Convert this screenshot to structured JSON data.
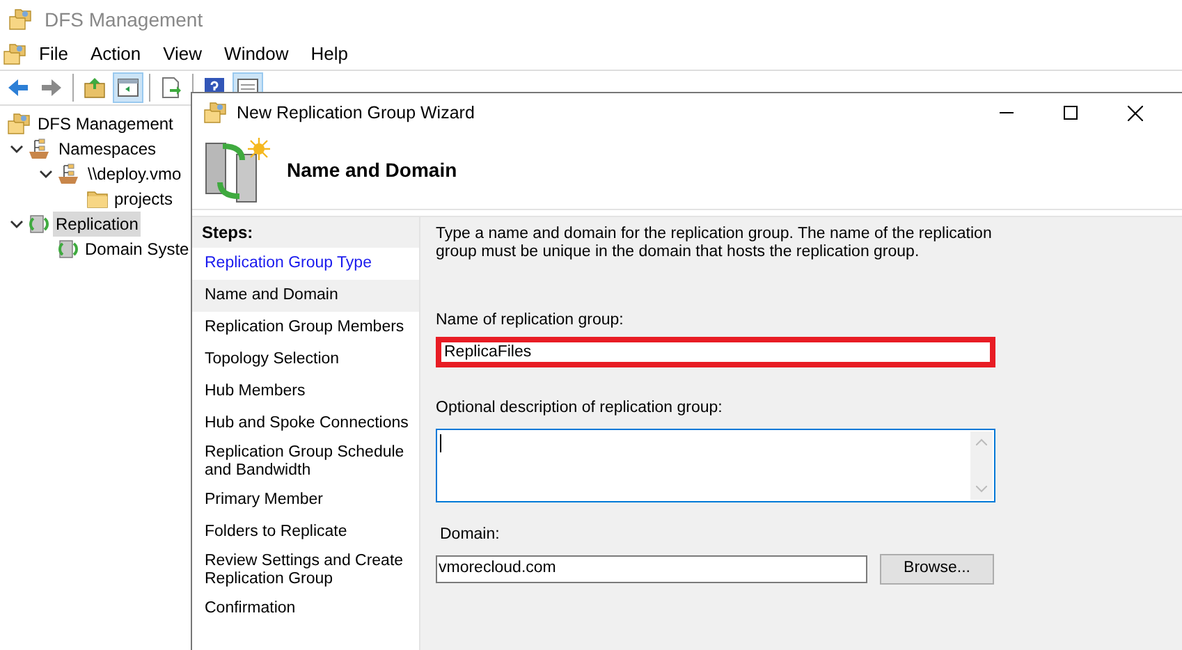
{
  "main_window": {
    "title": "DFS Management"
  },
  "menu": [
    "File",
    "Action",
    "View",
    "Window",
    "Help"
  ],
  "toolbar": [
    {
      "kind": "back",
      "pressed": false
    },
    {
      "kind": "forward",
      "pressed": false
    },
    {
      "kind": "separator"
    },
    {
      "kind": "up",
      "pressed": false
    },
    {
      "kind": "tree",
      "pressed": true
    },
    {
      "kind": "separator"
    },
    {
      "kind": "export",
      "pressed": false
    },
    {
      "kind": "separator"
    },
    {
      "kind": "help",
      "pressed": false
    },
    {
      "kind": "pane",
      "pressed": true
    }
  ],
  "tree": [
    {
      "label": "DFS Management",
      "kind": "root",
      "selected": false,
      "children": [
        {
          "label": "Namespaces",
          "kind": "namespaces",
          "expanded": true,
          "selected": false,
          "children": [
            {
              "label": "\\\\deploy.vmo",
              "kind": "namespace",
              "expanded": true,
              "selected": false,
              "children": [
                {
                  "label": "projects",
                  "kind": "folder",
                  "selected": false
                }
              ]
            }
          ]
        },
        {
          "label": "Replication",
          "kind": "replication",
          "expanded": true,
          "selected": true,
          "children": [
            {
              "label": "Domain Syste",
              "kind": "group",
              "selected": false
            }
          ]
        }
      ]
    }
  ],
  "wizard": {
    "title": "New Replication Group Wizard",
    "heading": "Name and Domain",
    "steps_header": "Steps:",
    "steps": [
      {
        "label": "Replication Group Type",
        "completed": true,
        "selected": false
      },
      {
        "label": "Name and Domain",
        "completed": false,
        "selected": true
      },
      {
        "label": "Replication Group Members",
        "completed": false,
        "selected": false
      },
      {
        "label": "Topology Selection",
        "completed": false,
        "selected": false
      },
      {
        "label": "Hub Members",
        "completed": false,
        "selected": false
      },
      {
        "label": "Hub and Spoke Connections",
        "completed": false,
        "selected": false
      },
      {
        "label": "Replication Group Schedule and Bandwidth",
        "completed": false,
        "selected": false
      },
      {
        "label": "Primary Member",
        "completed": false,
        "selected": false
      },
      {
        "label": "Folders to Replicate",
        "completed": false,
        "selected": false
      },
      {
        "label": "Review Settings and Create Replication Group",
        "completed": false,
        "selected": false
      },
      {
        "label": "Confirmation",
        "completed": false,
        "selected": false
      }
    ],
    "instructions": "Type a name and domain for the replication group. The name of the replication group must be unique in the domain that hosts the replication group.",
    "name_label": "Name of replication group:",
    "name_value": "ReplicaFiles",
    "description_label": "Optional description of replication group:",
    "domain_label": "Domain:",
    "domain_value": "vmorecloud.com",
    "browse_button": "Browse..."
  }
}
